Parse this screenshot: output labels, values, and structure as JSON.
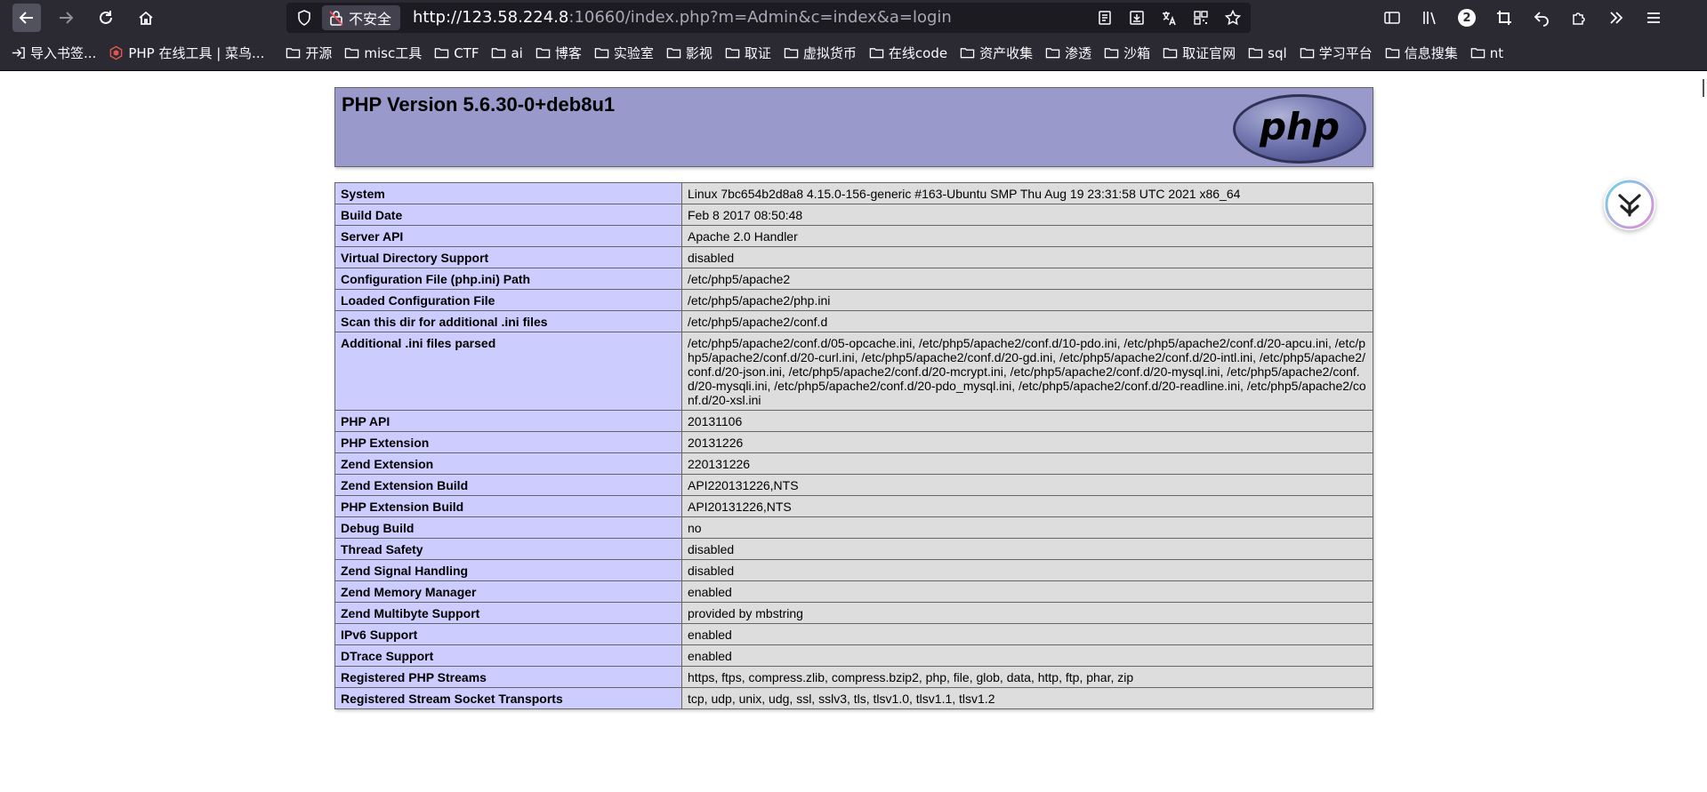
{
  "browser": {
    "security_label": "不安全",
    "url_host": "http://123.58.224.8",
    "url_rest": ":10660/index.php?m=Admin&c=index&a=login",
    "extension_badge_count": "2"
  },
  "bookmarks": [
    {
      "label": "导入书签...",
      "icon": "import-icon"
    },
    {
      "label": "PHP 在线工具 | 菜鸟...",
      "icon": "runoob-icon"
    },
    {
      "label": "开源",
      "icon": "folder-icon"
    },
    {
      "label": "misc工具",
      "icon": "folder-icon"
    },
    {
      "label": "CTF",
      "icon": "folder-icon"
    },
    {
      "label": "ai",
      "icon": "folder-icon"
    },
    {
      "label": "博客",
      "icon": "folder-icon"
    },
    {
      "label": "实验室",
      "icon": "folder-icon"
    },
    {
      "label": "影视",
      "icon": "folder-icon"
    },
    {
      "label": "取证",
      "icon": "folder-icon"
    },
    {
      "label": "虚拟货币",
      "icon": "folder-icon"
    },
    {
      "label": "在线code",
      "icon": "folder-icon"
    },
    {
      "label": "资产收集",
      "icon": "folder-icon"
    },
    {
      "label": "渗透",
      "icon": "folder-icon"
    },
    {
      "label": "沙箱",
      "icon": "folder-icon"
    },
    {
      "label": "取证官网",
      "icon": "folder-icon"
    },
    {
      "label": "sql",
      "icon": "folder-icon"
    },
    {
      "label": "学习平台",
      "icon": "folder-icon"
    },
    {
      "label": "信息搜集",
      "icon": "folder-icon"
    },
    {
      "label": "nt",
      "icon": "folder-icon"
    }
  ],
  "phpinfo": {
    "title": "PHP Version 5.6.30-0+deb8u1",
    "logo_text": "php",
    "colors": {
      "header": "#9999cc",
      "key_cell": "#ccccff",
      "value_cell": "#dddddd"
    },
    "rows": [
      {
        "key": "System",
        "value": "Linux 7bc654b2d8a8 4.15.0-156-generic #163-Ubuntu SMP Thu Aug 19 23:31:58 UTC 2021 x86_64"
      },
      {
        "key": "Build Date",
        "value": "Feb 8 2017 08:50:48"
      },
      {
        "key": "Server API",
        "value": "Apache 2.0 Handler"
      },
      {
        "key": "Virtual Directory Support",
        "value": "disabled"
      },
      {
        "key": "Configuration File (php.ini) Path",
        "value": "/etc/php5/apache2"
      },
      {
        "key": "Loaded Configuration File",
        "value": "/etc/php5/apache2/php.ini"
      },
      {
        "key": "Scan this dir for additional .ini files",
        "value": "/etc/php5/apache2/conf.d"
      },
      {
        "key": "Additional .ini files parsed",
        "value": "/etc/php5/apache2/conf.d/05-opcache.ini, /etc/php5/apache2/conf.d/10-pdo.ini, /etc/php5/apache2/conf.d/20-apcu.ini, /etc/php5/apache2/conf.d/20-curl.ini, /etc/php5/apache2/conf.d/20-gd.ini, /etc/php5/apache2/conf.d/20-intl.ini, /etc/php5/apache2/conf.d/20-json.ini, /etc/php5/apache2/conf.d/20-mcrypt.ini, /etc/php5/apache2/conf.d/20-mysql.ini, /etc/php5/apache2/conf.d/20-mysqli.ini, /etc/php5/apache2/conf.d/20-pdo_mysql.ini, /etc/php5/apache2/conf.d/20-readline.ini, /etc/php5/apache2/conf.d/20-xsl.ini"
      },
      {
        "key": "PHP API",
        "value": "20131106"
      },
      {
        "key": "PHP Extension",
        "value": "20131226"
      },
      {
        "key": "Zend Extension",
        "value": "220131226"
      },
      {
        "key": "Zend Extension Build",
        "value": "API220131226,NTS"
      },
      {
        "key": "PHP Extension Build",
        "value": "API20131226,NTS"
      },
      {
        "key": "Debug Build",
        "value": "no"
      },
      {
        "key": "Thread Safety",
        "value": "disabled"
      },
      {
        "key": "Zend Signal Handling",
        "value": "disabled"
      },
      {
        "key": "Zend Memory Manager",
        "value": "enabled"
      },
      {
        "key": "Zend Multibyte Support",
        "value": "provided by mbstring"
      },
      {
        "key": "IPv6 Support",
        "value": "enabled"
      },
      {
        "key": "DTrace Support",
        "value": "enabled"
      },
      {
        "key": "Registered PHP Streams",
        "value": "https, ftps, compress.zlib, compress.bzip2, php, file, glob, data, http, ftp, phar, zip"
      },
      {
        "key": "Registered Stream Socket Transports",
        "value": "tcp, udp, unix, udg, ssl, sslv3, tls, tlsv1.0, tlsv1.1, tlsv1.2"
      }
    ]
  }
}
